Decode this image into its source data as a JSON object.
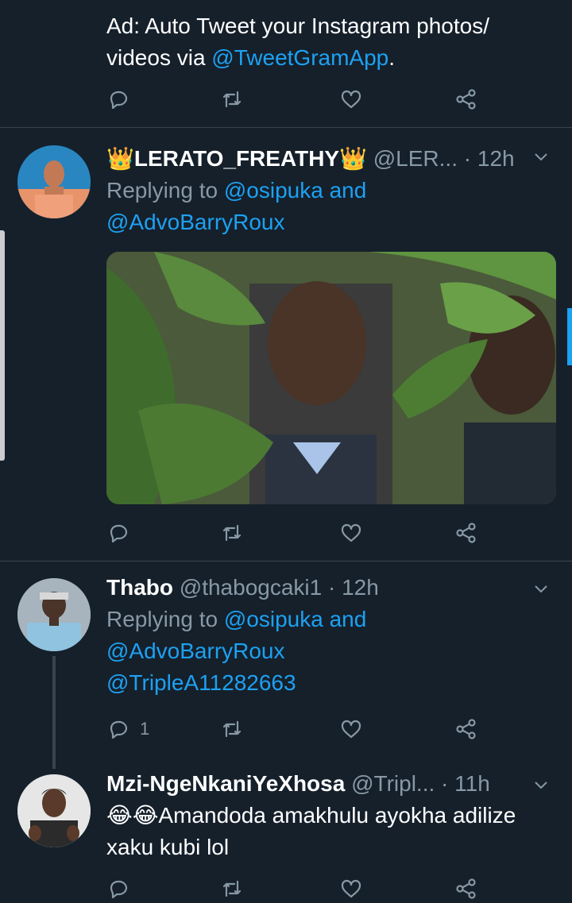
{
  "colors": {
    "background": "#15202b",
    "link": "#1da1f2",
    "muted": "#8899a6",
    "divider": "#38444d"
  },
  "ad_tweet": {
    "text_line1": "Ad: Auto Tweet your Instagram photos/",
    "text_line2_prefix": "videos via ",
    "text_line2_link": "@TweetGramApp",
    "text_line2_suffix": "."
  },
  "tweets": [
    {
      "name": "👑LERATO_FREATHY👑",
      "handle": "@LER...",
      "time": "· 12h",
      "replying_prefix": "Replying to ",
      "replying_to_1": "@osipuka",
      "replying_and": " and",
      "replying_to_2": "@AdvoBarryRoux",
      "has_media": true
    },
    {
      "name": "Thabo",
      "handle": "@thabogcaki1",
      "time": "· 12h",
      "replying_prefix": "Replying to ",
      "replying_to_1": "@osipuka",
      "replying_and": " and",
      "replying_to_2": "@AdvoBarryRoux",
      "body_link": "@TripleA11282663",
      "reply_count": "1"
    },
    {
      "name": "Mzi-NgeNkaniYeXhosa",
      "handle": "@Tripl...",
      "time": "· 11h",
      "text_line1": "😂😂Amandoda amakhulu ayokha adilize",
      "text_line2": "xaku kubi lol"
    }
  ],
  "icons": [
    "reply-icon",
    "retweet-icon",
    "like-icon",
    "share-icon",
    "chevron-down-icon"
  ]
}
